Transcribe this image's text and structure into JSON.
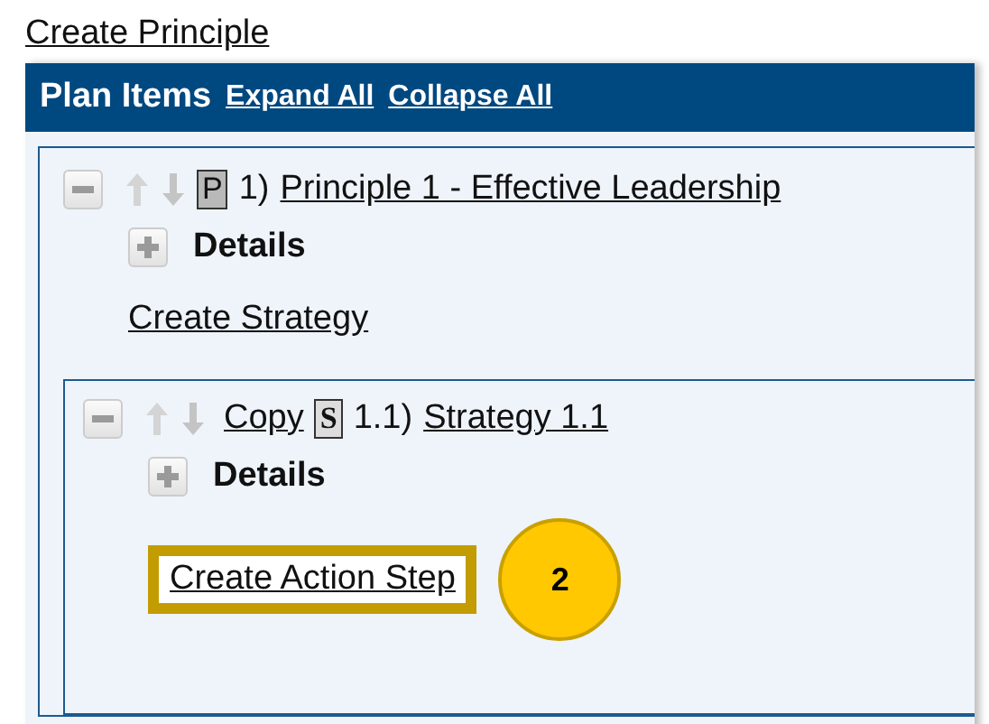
{
  "create_link": "Create Principle",
  "header": {
    "title": "Plan Items",
    "links": [
      "Expand All",
      "Collapse All"
    ]
  },
  "principle": {
    "expanded": true,
    "badge": "P",
    "number": "1)",
    "title": "Principle 1 - Effective Leadership",
    "details": {
      "label": "Details",
      "expanded": false
    },
    "create_link": "Create Strategy",
    "strategy": {
      "expanded": true,
      "copy": "Copy",
      "badge": "S",
      "number": "1.1)",
      "title": "Strategy 1.1",
      "details": {
        "label": "Details",
        "expanded": false
      },
      "create_link": "Create Action Step",
      "highlighted": true,
      "callout": "2"
    }
  }
}
